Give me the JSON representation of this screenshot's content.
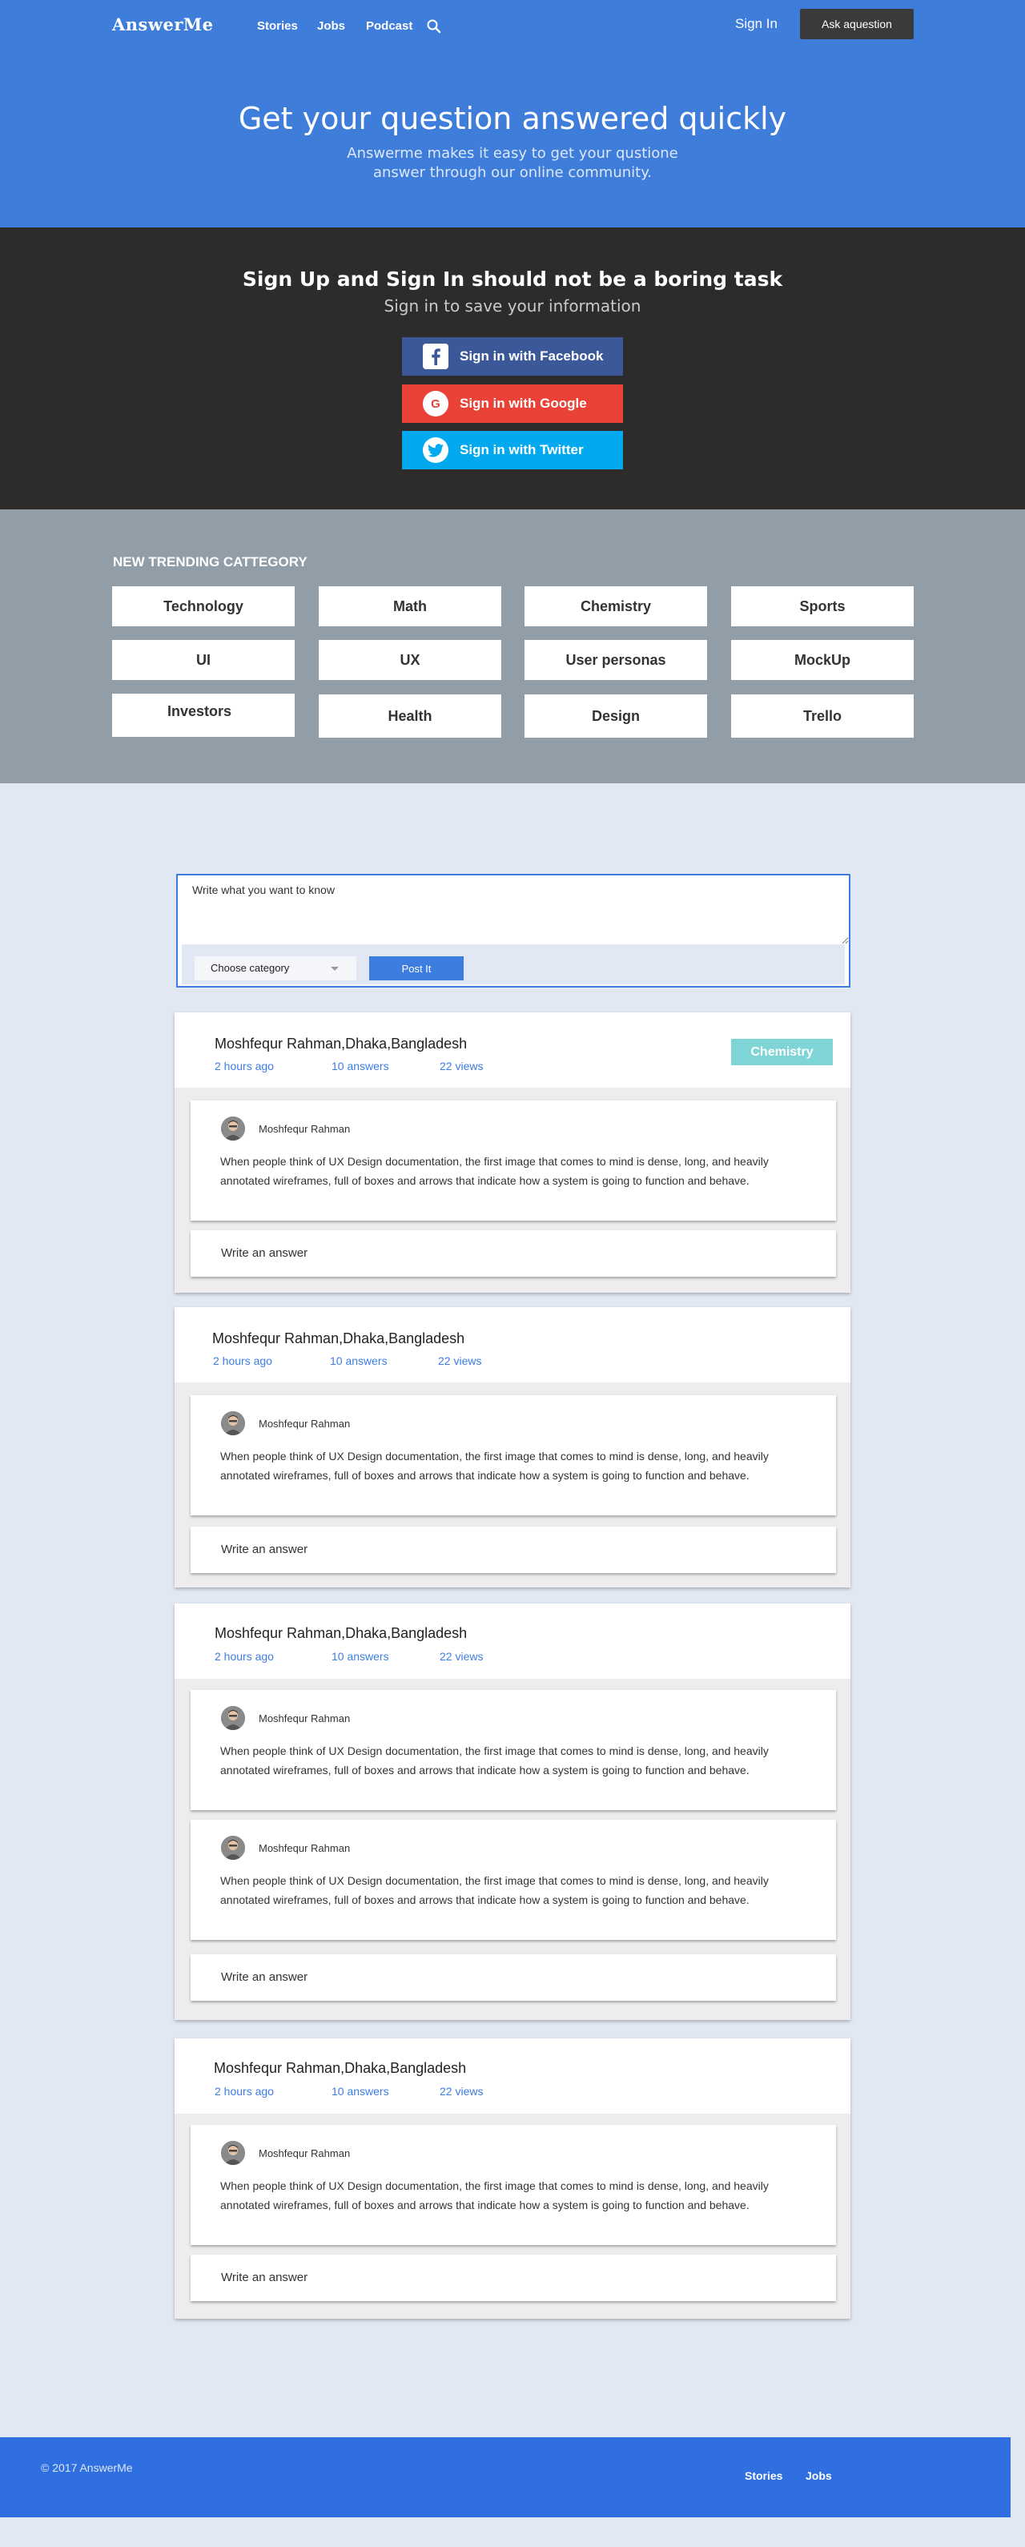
{
  "header": {
    "logo": "AnswerMe",
    "nav": [
      "Stories",
      "Jobs",
      "Podcast"
    ],
    "sign_in": "Sign In",
    "ask_button": "Ask aquestion"
  },
  "hero": {
    "title": "Get your question answered quickly",
    "subtitle": "Answerme makes it easy to get your qustione answer through our online community."
  },
  "signin": {
    "title": "Sign Up and Sign In should not be a boring task",
    "subtitle": "Sign in to save your information",
    "facebook": "Sign in with Facebook",
    "google": "Sign in with Google",
    "twitter": "Sign in with Twitter"
  },
  "trending": {
    "title": "NEW TRENDING CATTEGORY",
    "categories": [
      "Technology",
      "Math",
      "Chemistry",
      "Sports",
      "UI",
      "UX",
      "User personas",
      "MockUp",
      "Investors",
      "Health",
      "Design",
      "Trello"
    ]
  },
  "ask_box": {
    "placeholder": "Write what you want to know",
    "category_select": "Choose category",
    "post_button": "Post It"
  },
  "questions": [
    {
      "author": "Moshfequr Rahman,Dhaka,Bangladesh",
      "time": "2 hours ago",
      "answers": "10 answers",
      "views": "22 views",
      "tag": "Chemistry",
      "replies": [
        {
          "author": "Moshfequr Rahman",
          "text": "When people think of UX Design documentation, the first image that comes to mind is dense, long, and heavily annotated wireframes, full of boxes and arrows that indicate how a system is going to function and behave."
        }
      ],
      "write_answer": "Write an answer"
    },
    {
      "author": "Moshfequr Rahman,Dhaka,Bangladesh",
      "time": "2 hours ago",
      "answers": "10 answers",
      "views": "22 views",
      "replies": [
        {
          "author": "Moshfequr Rahman",
          "text": "When people think of UX Design documentation, the first image that comes to mind is dense, long, and heavily annotated wireframes, full of boxes and arrows that indicate how a system is going to function and behave."
        }
      ],
      "write_answer": "Write an answer"
    },
    {
      "author": "Moshfequr Rahman,Dhaka,Bangladesh",
      "time": "2 hours ago",
      "answers": "10 answers",
      "views": "22 views",
      "replies": [
        {
          "author": "Moshfequr Rahman",
          "text": "When people think of UX Design documentation, the first image that comes to mind is dense, long, and heavily annotated wireframes, full of boxes and arrows that indicate how a system is going to function and behave."
        },
        {
          "author": "Moshfequr Rahman",
          "text": "When people think of UX Design documentation, the first image that comes to mind is dense, long, and heavily annotated wireframes, full of boxes and arrows that indicate how a system is going to function and behave."
        }
      ],
      "write_answer": "Write an answer"
    },
    {
      "author": "Moshfequr Rahman,Dhaka,Bangladesh",
      "time": "2 hours ago",
      "answers": "10 answers",
      "views": "22 views",
      "replies": [
        {
          "author": "Moshfequr Rahman",
          "text": "When people think of UX Design documentation, the first image that comes to mind is dense, long, and heavily annotated wireframes, full of boxes and arrows that indicate how a system is going to function and behave."
        }
      ],
      "write_answer": "Write an answer"
    }
  ],
  "footer": {
    "copyright": "© 2017 AnswerMe",
    "links": [
      "Stories",
      "Jobs"
    ]
  },
  "colors": {
    "brand_blue": "#3f7ddb",
    "dark": "#2d2c2b",
    "facebook": "#3b5898",
    "google": "#ea4236",
    "twitter": "#02a9ef",
    "tag": "#7fd4d6"
  }
}
